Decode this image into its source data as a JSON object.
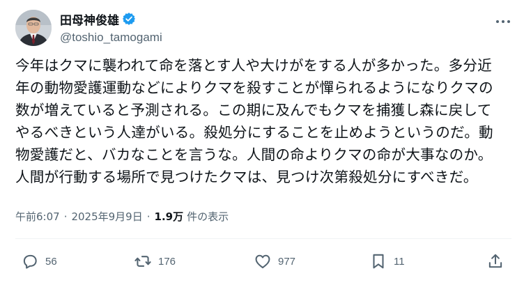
{
  "author": {
    "display_name": "田母神俊雄",
    "handle": "@toshio_tamogami",
    "verified": true
  },
  "post": {
    "text": "今年はクマに襲われて命を落とす人や大けがをする人が多かった。多分近\n年の動物愛護運動などによりクマを殺すことが憚られるようになりクマの\n数が増えていると予測される。この期に及んでもクマを捕獲し森に戻して\nやるべきという人達がいる。殺処分にすることを止めようというのだ。動\n物愛護だと、バカなことを言うな。人間の命よりクマの命が大事なのか。\n人間が行動する場所で見つけたクマは、見つけ次第殺処分にすべきだ。"
  },
  "meta": {
    "time": "午前6:07",
    "separator": "·",
    "date": "2025年9月9日",
    "views_count": "1.9万",
    "views_label": "件の表示"
  },
  "actions": {
    "replies": "56",
    "reposts": "176",
    "likes": "977",
    "bookmarks": "11"
  },
  "icons": {
    "verified": "verified-badge-icon",
    "more": "more-dots-icon",
    "reply": "reply-icon",
    "repost": "repost-icon",
    "like": "heart-icon",
    "bookmark": "bookmark-icon",
    "share": "share-icon"
  },
  "colors": {
    "text_primary": "#0f1419",
    "text_secondary": "#536471",
    "verified_blue": "#1d9bf0",
    "divider": "#eff3f4"
  }
}
